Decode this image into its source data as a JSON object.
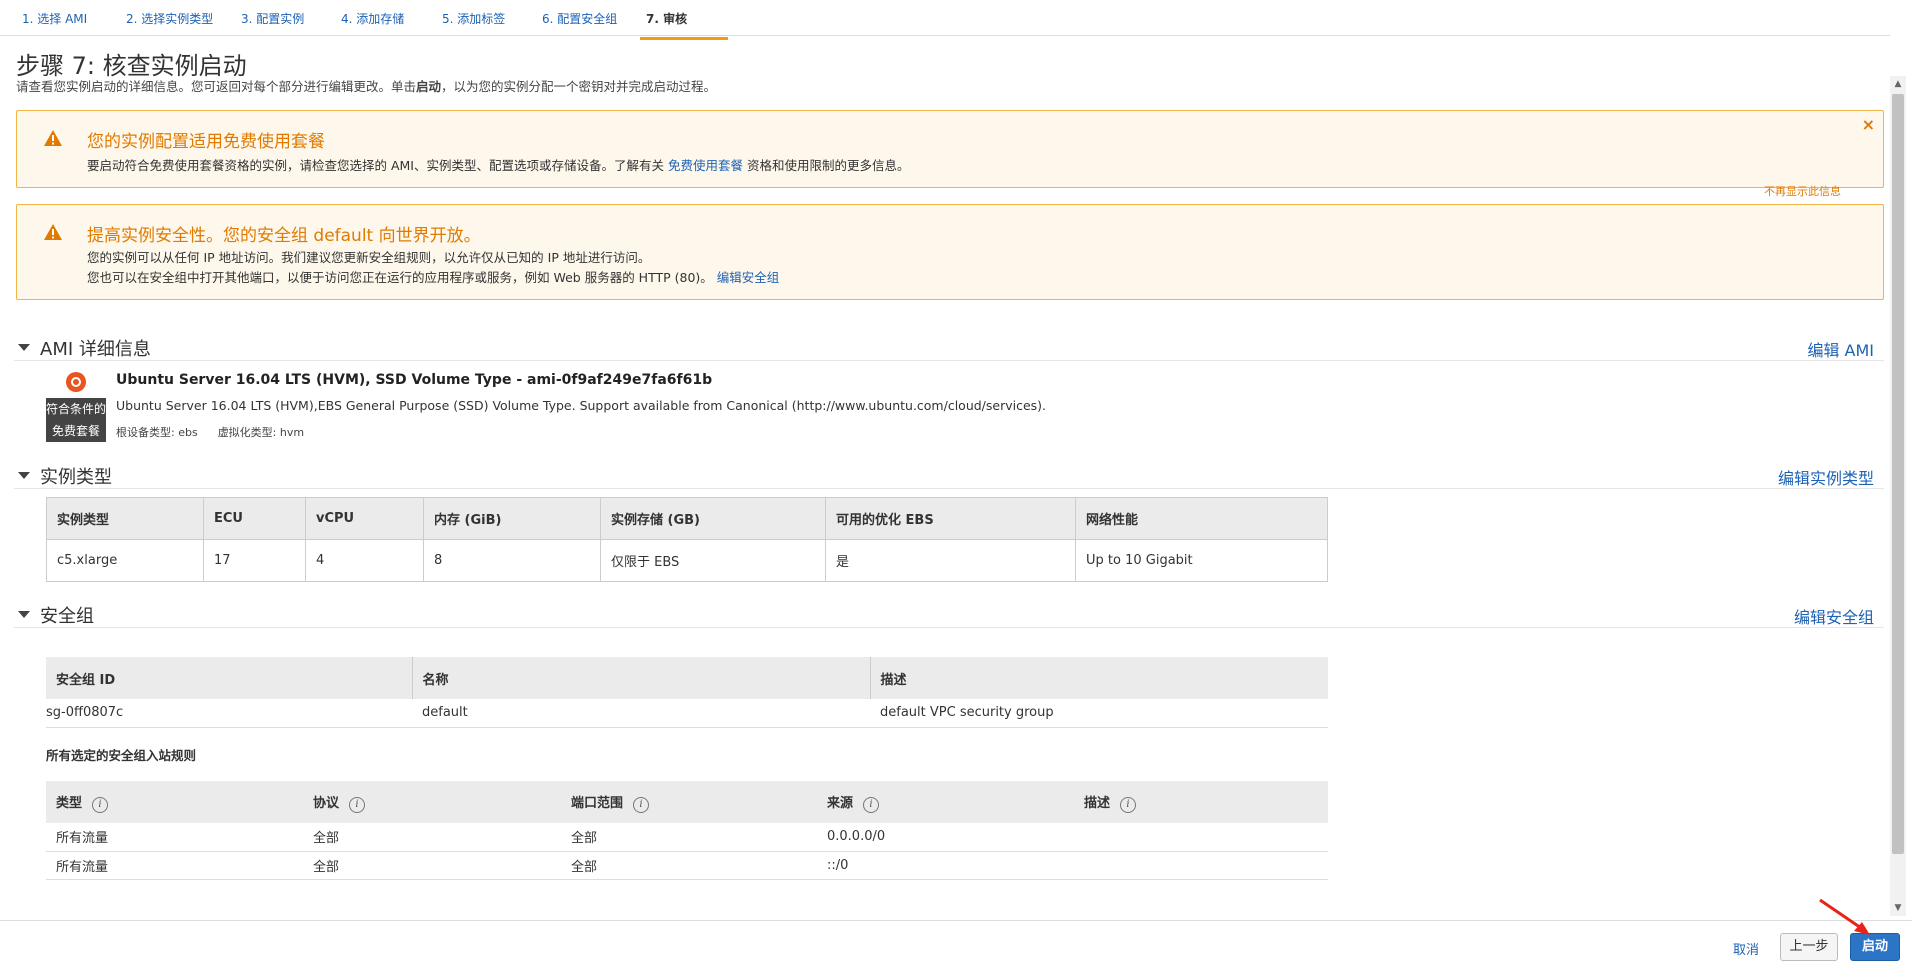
{
  "steps": [
    {
      "label": "1. 选择 AMI"
    },
    {
      "label": "2. 选择实例类型"
    },
    {
      "label": "3. 配置实例"
    },
    {
      "label": "4. 添加存储"
    },
    {
      "label": "5. 添加标签"
    },
    {
      "label": "6. 配置安全组"
    },
    {
      "label": "7. 审核"
    }
  ],
  "page": {
    "title": "步骤 7: 核查实例启动",
    "subtitle_before": "请查看您实例启动的详细信息。您可返回对每个部分进行编辑更改。单击",
    "subtitle_bold": "启动",
    "subtitle_after": "，以为您的实例分配一个密钥对并完成启动过程。"
  },
  "alerts": {
    "free_tier": {
      "title": "您的实例配置适用免费使用套餐",
      "text_before": "要启动符合免费使用套餐资格的实例，请检查您选择的 AMI、实例类型、配置选项或存储设备。了解有关",
      "link": "免费使用套餐",
      "text_after": "资格和使用限制的更多信息。",
      "close": "×",
      "dont_show": "不再显示此信息"
    },
    "security": {
      "title": "提高实例安全性。您的安全组 default 向世界开放。",
      "line1": "您的实例可以从任何 IP 地址访问。我们建议您更新安全组规则，以允许仅从已知的 IP 地址进行访问。",
      "line2_before": "您也可以在安全组中打开其他端口，以便于访问您正在运行的应用程序或服务，例如 Web 服务器的 HTTP (80)。",
      "link": "编辑安全组"
    }
  },
  "ami": {
    "section_title": "AMI 详细信息",
    "edit": "编辑 AMI",
    "badge_line1": "符合条件的",
    "badge_line2": "免费套餐",
    "name": "Ubuntu Server 16.04 LTS (HVM), SSD Volume Type - ami-0f9af249e7fa6f61b",
    "description": "Ubuntu Server 16.04 LTS (HVM),EBS General Purpose (SSD) Volume Type. Support available from Canonical (http://www.ubuntu.com/cloud/services).",
    "root_device": "根设备类型: ebs",
    "virtualization": "虚拟化类型: hvm"
  },
  "instance_type": {
    "section_title": "实例类型",
    "edit": "编辑实例类型",
    "headers": [
      "实例类型",
      "ECU",
      "vCPU",
      "内存 (GiB)",
      "实例存储 (GB)",
      "可用的优化 EBS",
      "网络性能"
    ],
    "row": [
      "c5.xlarge",
      "17",
      "4",
      "8",
      "仅限于 EBS",
      "是",
      "Up to 10 Gigabit"
    ]
  },
  "security_groups": {
    "section_title": "安全组",
    "edit": "编辑安全组",
    "headers": [
      "安全组 ID",
      "名称",
      "描述"
    ],
    "row": [
      "sg-0ff0807c",
      "default",
      "default VPC security group"
    ],
    "rules_label": "所有选定的安全组入站规则",
    "rule_headers": [
      "类型",
      "协议",
      "端口范围",
      "来源",
      "描述"
    ],
    "rules": [
      [
        "所有流量",
        "全部",
        "全部",
        "0.0.0.0/0",
        ""
      ],
      [
        "所有流量",
        "全部",
        "全部",
        "::/0",
        ""
      ]
    ]
  },
  "footer": {
    "cancel": "取消",
    "previous": "上一步",
    "launch": "启动"
  },
  "colors": {
    "link": "#1d62b5",
    "warning": "#e07b00",
    "alert_bg": "#fef7eb",
    "primary_button": "#2b74c6",
    "annotation_arrow": "#e8231a"
  }
}
